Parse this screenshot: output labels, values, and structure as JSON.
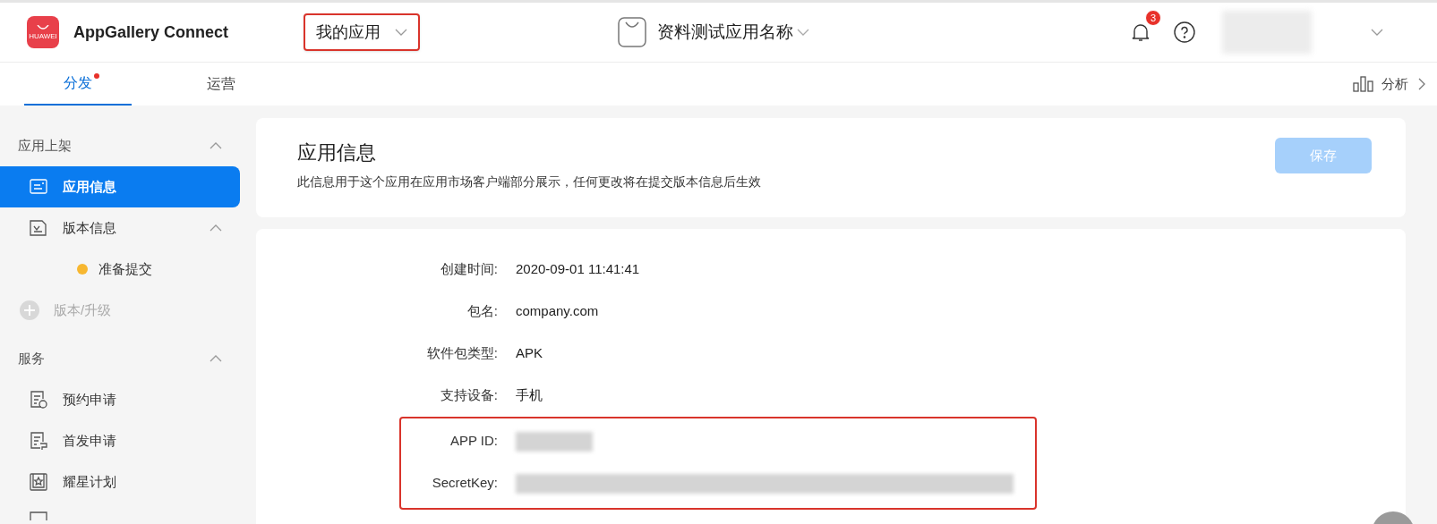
{
  "header": {
    "brand": "AppGallery Connect",
    "logo_text": "HUAWEI",
    "app_menu": {
      "label": "我的应用",
      "highlighted": true
    },
    "app_name": "资料测试应用名称",
    "notifications": "3"
  },
  "tabs": [
    {
      "label": "分发",
      "selected": true,
      "dot": true
    },
    {
      "label": "运营",
      "selected": false,
      "dot": false
    }
  ],
  "analysis_link": "分析",
  "sidebar": [
    {
      "kind": "section",
      "label": "应用上架",
      "expanded": true
    },
    {
      "kind": "item",
      "label": "应用信息",
      "selected": true,
      "expanded": false
    },
    {
      "kind": "item",
      "label": "版本信息",
      "selected": false,
      "expanded": true
    },
    {
      "kind": "status",
      "label": "准备提交",
      "color": "#f7b730"
    },
    {
      "kind": "add",
      "label": "版本/升级",
      "disabled": true
    },
    {
      "kind": "section",
      "label": "服务",
      "expanded": true
    },
    {
      "kind": "item",
      "label": "预约申请",
      "selected": false
    },
    {
      "kind": "item",
      "label": "首发申请",
      "selected": false
    },
    {
      "kind": "item",
      "label": "耀星计划",
      "selected": false
    }
  ],
  "page": {
    "title": "应用信息",
    "description": "此信息用于这个应用在应用市场客户端部分展示，任何更改将在提交版本信息后生效",
    "save_button": {
      "label": "保存",
      "disabled": true
    }
  },
  "info_rows": [
    {
      "label": "创建时间:",
      "value": "2020-09-01 11:41:41",
      "highlighted": false
    },
    {
      "label": "包名:",
      "value": "company.com",
      "highlighted": false
    },
    {
      "label": "软件包类型:",
      "value": "APK",
      "highlighted": false
    },
    {
      "label": "支持设备:",
      "value": "手机",
      "highlighted": false
    },
    {
      "label": "APP ID:",
      "kind": "redacted",
      "highlighted": true
    },
    {
      "label": "SecretKey:",
      "kind": "redacted",
      "highlighted": true
    }
  ]
}
